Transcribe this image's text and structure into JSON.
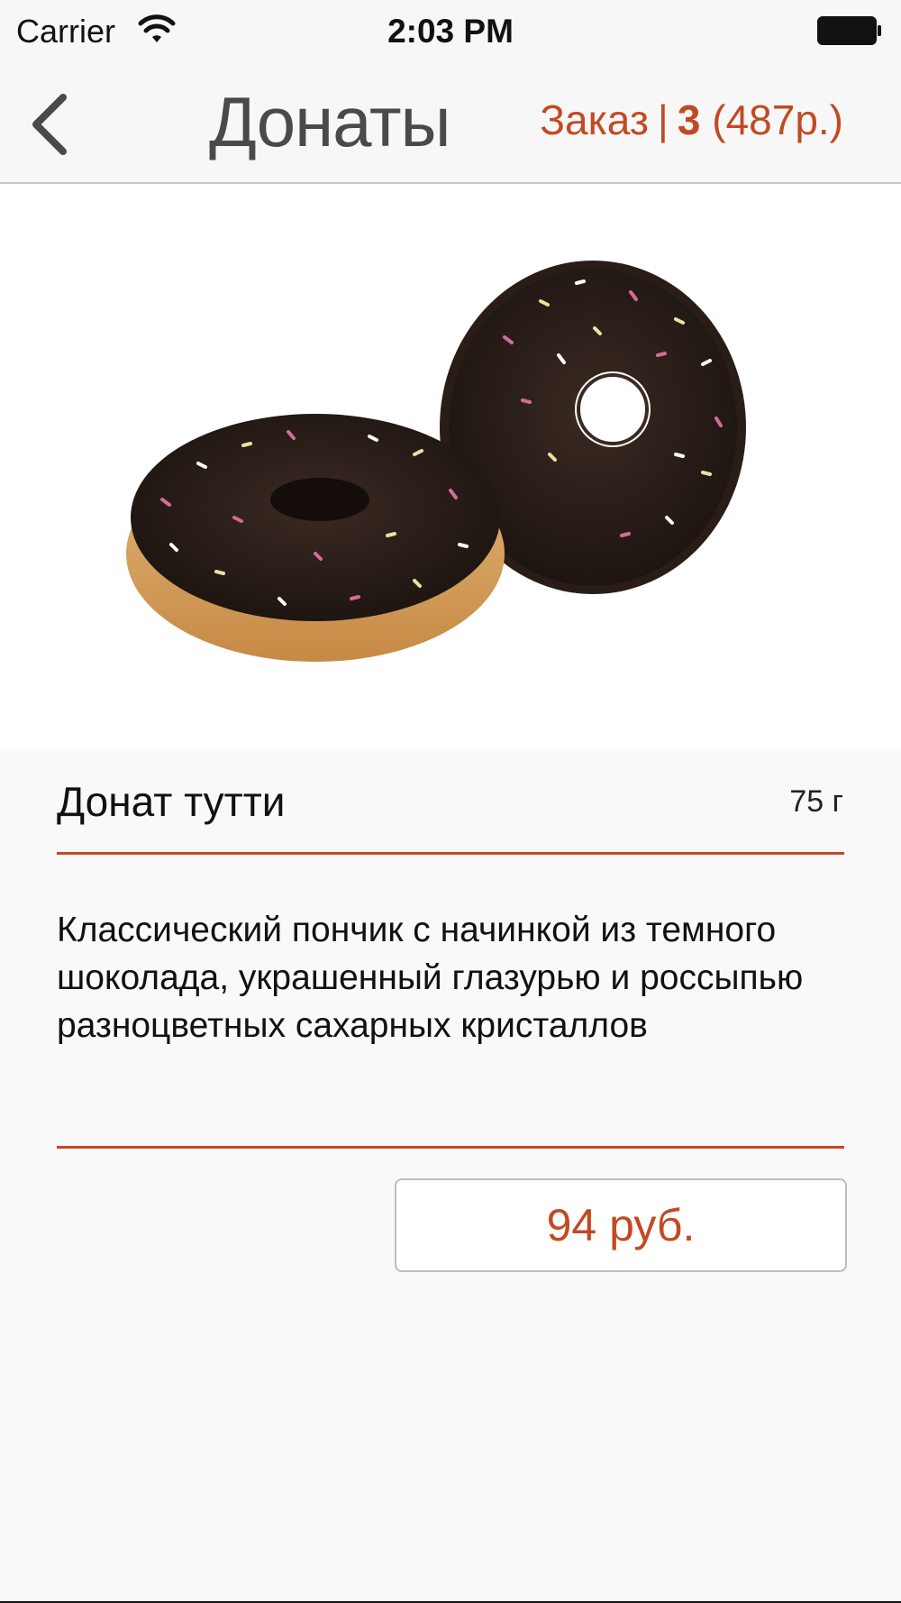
{
  "status_bar": {
    "carrier": "Carrier",
    "time": "2:03 PM"
  },
  "nav": {
    "title": "Донаты",
    "order_label": "Заказ",
    "order_count": "3",
    "order_total": "(487р.)"
  },
  "product": {
    "name": "Донат тутти",
    "weight": "75 г",
    "description": "Классический пончик с начинкой из темного шоколада, украшенный глазурью и россыпью разноцветных сахарных кристаллов",
    "price": "94 руб."
  },
  "icons": {
    "back": "chevron-left-icon",
    "wifi": "wifi-icon",
    "battery": "battery-icon"
  },
  "colors": {
    "accent": "#c24a22",
    "title": "#4a4a4a",
    "background": "#f9f9f9"
  }
}
